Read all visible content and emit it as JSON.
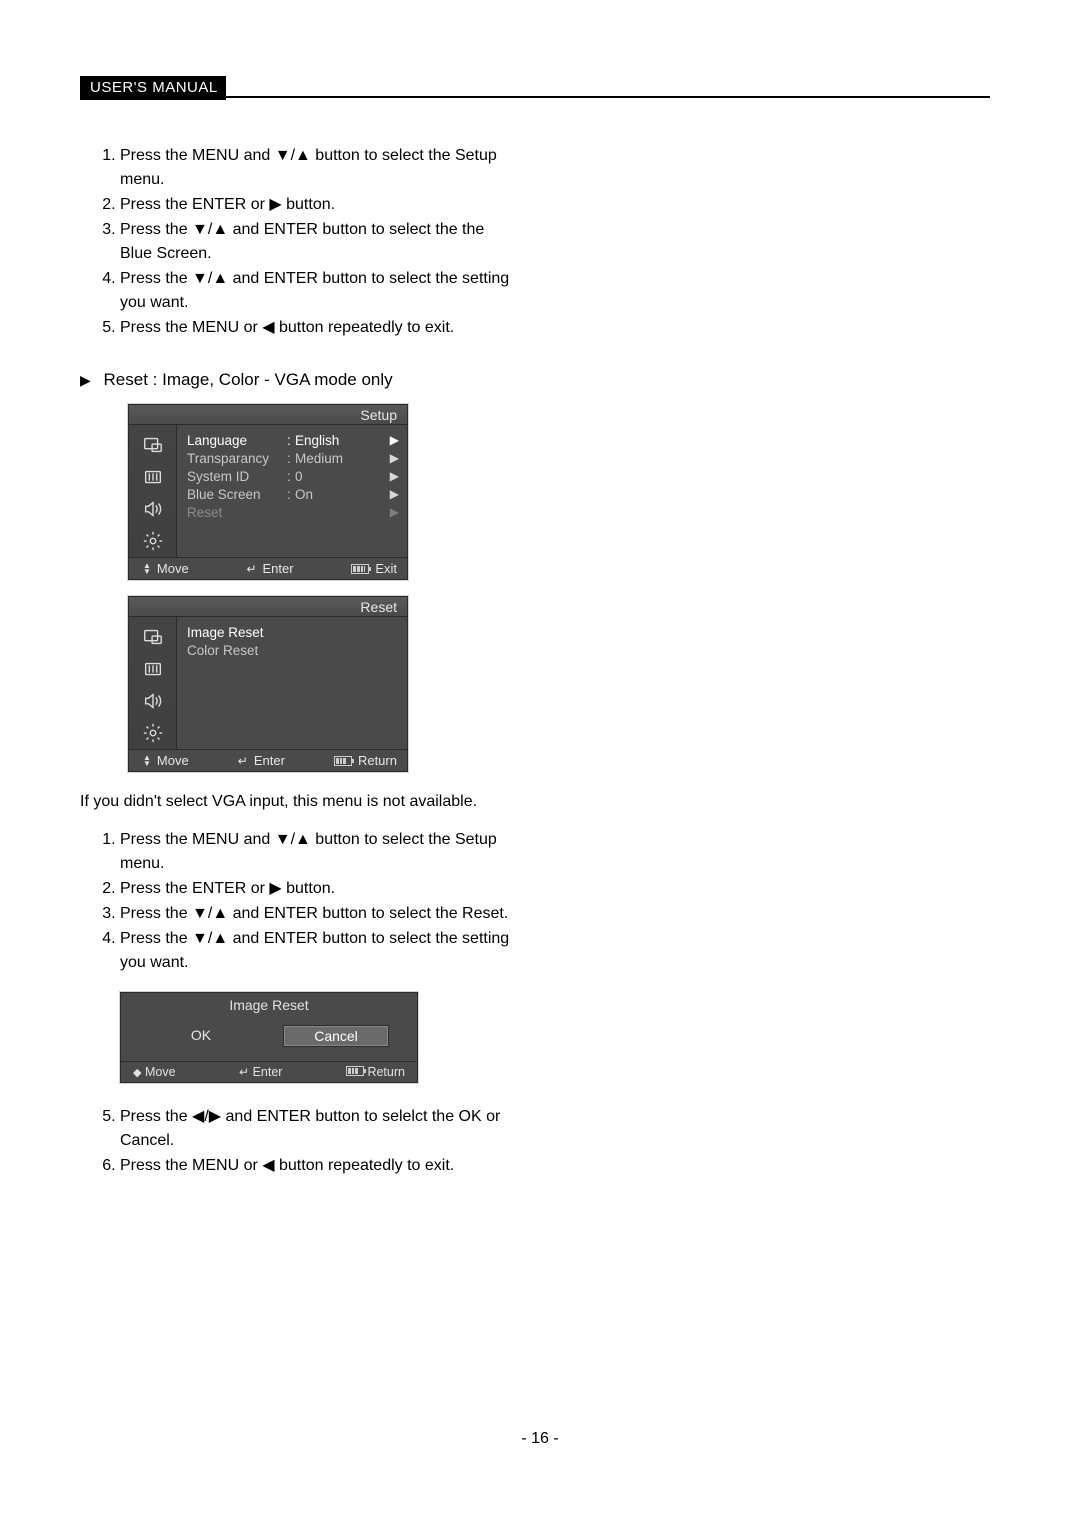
{
  "header": {
    "badge": "USER'S MANUAL"
  },
  "steps1": [
    "Press the MENU and ▼/▲ button to select the Setup menu.",
    "Press the ENTER or ▶ button.",
    "Press the ▼/▲ and ENTER button to select the the Blue Screen.",
    "Press the ▼/▲ and ENTER button to select the setting you want.",
    "Press the MENU or ◀ button repeatedly to exit."
  ],
  "section_reset_title": "Reset : Image, Color - VGA mode only",
  "osd_setup": {
    "title": "Setup",
    "rows": [
      {
        "label": "Language",
        "value": "English",
        "hl": true,
        "arrow_hl": true
      },
      {
        "label": "Transparancy",
        "value": "Medium",
        "hl": false,
        "arrow_hl": false
      },
      {
        "label": "System ID",
        "value": "0",
        "hl": false,
        "arrow_hl": false
      },
      {
        "label": "Blue Screen",
        "value": "On",
        "hl": false,
        "arrow_hl": false
      },
      {
        "label": "Reset",
        "value": "",
        "hl": false,
        "arrow_hl": false,
        "dim": true
      }
    ],
    "foot": {
      "move": "Move",
      "enter": "Enter",
      "exit": "Exit"
    }
  },
  "osd_reset": {
    "title": "Reset",
    "rows": [
      {
        "label": "Image Reset",
        "hl": true
      },
      {
        "label": "Color Reset",
        "hl": false
      }
    ],
    "foot": {
      "move": "Move",
      "enter": "Enter",
      "return": "Return"
    }
  },
  "vga_note": "If you didn't select VGA input, this menu is not available.",
  "steps2": [
    "Press the MENU and ▼/▲ button to select the Setup menu.",
    "Press the ENTER or ▶ button.",
    "Press the ▼/▲ and ENTER button to select the Reset.",
    "Press the ▼/▲ and ENTER button to select the setting you want."
  ],
  "dialog": {
    "title": "Image Reset",
    "ok": "OK",
    "cancel": "Cancel",
    "foot": {
      "move": "Move",
      "enter": "Enter",
      "return": "Return"
    }
  },
  "steps3": [
    "Press the ◀/▶ and ENTER button to selelct the OK or Cancel.",
    "Press the MENU or ◀ button repeatedly to exit."
  ],
  "page_number": "- 16 -"
}
